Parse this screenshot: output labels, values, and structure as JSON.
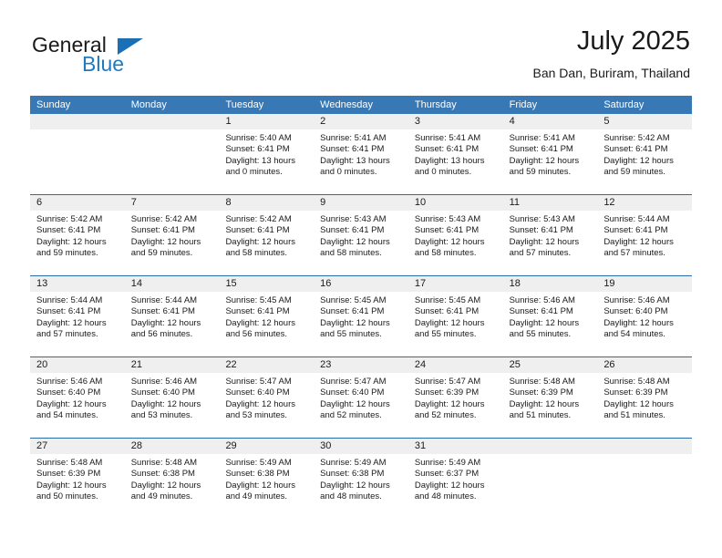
{
  "brand": {
    "name_top": "General",
    "name_bottom": "Blue",
    "accent_color": "#1f7bc1"
  },
  "header": {
    "title": "July 2025",
    "subtitle": "Ban Dan, Buriram, Thailand"
  },
  "theme": {
    "header_blue": "#3878b4",
    "row_divider_blue": "#2c6ca8",
    "day_band_gray": "#efefef"
  },
  "weekdays": [
    "Sunday",
    "Monday",
    "Tuesday",
    "Wednesday",
    "Thursday",
    "Friday",
    "Saturday"
  ],
  "weeks": [
    [
      {
        "day": "",
        "empty": true,
        "sunrise": "",
        "sunset": "",
        "daylight_1": "",
        "daylight_2": ""
      },
      {
        "day": "",
        "empty": true,
        "sunrise": "",
        "sunset": "",
        "daylight_1": "",
        "daylight_2": ""
      },
      {
        "day": "1",
        "sunrise": "Sunrise: 5:40 AM",
        "sunset": "Sunset: 6:41 PM",
        "daylight_1": "Daylight: 13 hours",
        "daylight_2": "and 0 minutes."
      },
      {
        "day": "2",
        "sunrise": "Sunrise: 5:41 AM",
        "sunset": "Sunset: 6:41 PM",
        "daylight_1": "Daylight: 13 hours",
        "daylight_2": "and 0 minutes."
      },
      {
        "day": "3",
        "sunrise": "Sunrise: 5:41 AM",
        "sunset": "Sunset: 6:41 PM",
        "daylight_1": "Daylight: 13 hours",
        "daylight_2": "and 0 minutes."
      },
      {
        "day": "4",
        "sunrise": "Sunrise: 5:41 AM",
        "sunset": "Sunset: 6:41 PM",
        "daylight_1": "Daylight: 12 hours",
        "daylight_2": "and 59 minutes."
      },
      {
        "day": "5",
        "sunrise": "Sunrise: 5:42 AM",
        "sunset": "Sunset: 6:41 PM",
        "daylight_1": "Daylight: 12 hours",
        "daylight_2": "and 59 minutes."
      }
    ],
    [
      {
        "day": "6",
        "sunrise": "Sunrise: 5:42 AM",
        "sunset": "Sunset: 6:41 PM",
        "daylight_1": "Daylight: 12 hours",
        "daylight_2": "and 59 minutes."
      },
      {
        "day": "7",
        "sunrise": "Sunrise: 5:42 AM",
        "sunset": "Sunset: 6:41 PM",
        "daylight_1": "Daylight: 12 hours",
        "daylight_2": "and 59 minutes."
      },
      {
        "day": "8",
        "sunrise": "Sunrise: 5:42 AM",
        "sunset": "Sunset: 6:41 PM",
        "daylight_1": "Daylight: 12 hours",
        "daylight_2": "and 58 minutes."
      },
      {
        "day": "9",
        "sunrise": "Sunrise: 5:43 AM",
        "sunset": "Sunset: 6:41 PM",
        "daylight_1": "Daylight: 12 hours",
        "daylight_2": "and 58 minutes."
      },
      {
        "day": "10",
        "sunrise": "Sunrise: 5:43 AM",
        "sunset": "Sunset: 6:41 PM",
        "daylight_1": "Daylight: 12 hours",
        "daylight_2": "and 58 minutes."
      },
      {
        "day": "11",
        "sunrise": "Sunrise: 5:43 AM",
        "sunset": "Sunset: 6:41 PM",
        "daylight_1": "Daylight: 12 hours",
        "daylight_2": "and 57 minutes."
      },
      {
        "day": "12",
        "sunrise": "Sunrise: 5:44 AM",
        "sunset": "Sunset: 6:41 PM",
        "daylight_1": "Daylight: 12 hours",
        "daylight_2": "and 57 minutes."
      }
    ],
    [
      {
        "day": "13",
        "sunrise": "Sunrise: 5:44 AM",
        "sunset": "Sunset: 6:41 PM",
        "daylight_1": "Daylight: 12 hours",
        "daylight_2": "and 57 minutes."
      },
      {
        "day": "14",
        "sunrise": "Sunrise: 5:44 AM",
        "sunset": "Sunset: 6:41 PM",
        "daylight_1": "Daylight: 12 hours",
        "daylight_2": "and 56 minutes."
      },
      {
        "day": "15",
        "sunrise": "Sunrise: 5:45 AM",
        "sunset": "Sunset: 6:41 PM",
        "daylight_1": "Daylight: 12 hours",
        "daylight_2": "and 56 minutes."
      },
      {
        "day": "16",
        "sunrise": "Sunrise: 5:45 AM",
        "sunset": "Sunset: 6:41 PM",
        "daylight_1": "Daylight: 12 hours",
        "daylight_2": "and 55 minutes."
      },
      {
        "day": "17",
        "sunrise": "Sunrise: 5:45 AM",
        "sunset": "Sunset: 6:41 PM",
        "daylight_1": "Daylight: 12 hours",
        "daylight_2": "and 55 minutes."
      },
      {
        "day": "18",
        "sunrise": "Sunrise: 5:46 AM",
        "sunset": "Sunset: 6:41 PM",
        "daylight_1": "Daylight: 12 hours",
        "daylight_2": "and 55 minutes."
      },
      {
        "day": "19",
        "sunrise": "Sunrise: 5:46 AM",
        "sunset": "Sunset: 6:40 PM",
        "daylight_1": "Daylight: 12 hours",
        "daylight_2": "and 54 minutes."
      }
    ],
    [
      {
        "day": "20",
        "sunrise": "Sunrise: 5:46 AM",
        "sunset": "Sunset: 6:40 PM",
        "daylight_1": "Daylight: 12 hours",
        "daylight_2": "and 54 minutes."
      },
      {
        "day": "21",
        "sunrise": "Sunrise: 5:46 AM",
        "sunset": "Sunset: 6:40 PM",
        "daylight_1": "Daylight: 12 hours",
        "daylight_2": "and 53 minutes."
      },
      {
        "day": "22",
        "sunrise": "Sunrise: 5:47 AM",
        "sunset": "Sunset: 6:40 PM",
        "daylight_1": "Daylight: 12 hours",
        "daylight_2": "and 53 minutes."
      },
      {
        "day": "23",
        "sunrise": "Sunrise: 5:47 AM",
        "sunset": "Sunset: 6:40 PM",
        "daylight_1": "Daylight: 12 hours",
        "daylight_2": "and 52 minutes."
      },
      {
        "day": "24",
        "sunrise": "Sunrise: 5:47 AM",
        "sunset": "Sunset: 6:39 PM",
        "daylight_1": "Daylight: 12 hours",
        "daylight_2": "and 52 minutes."
      },
      {
        "day": "25",
        "sunrise": "Sunrise: 5:48 AM",
        "sunset": "Sunset: 6:39 PM",
        "daylight_1": "Daylight: 12 hours",
        "daylight_2": "and 51 minutes."
      },
      {
        "day": "26",
        "sunrise": "Sunrise: 5:48 AM",
        "sunset": "Sunset: 6:39 PM",
        "daylight_1": "Daylight: 12 hours",
        "daylight_2": "and 51 minutes."
      }
    ],
    [
      {
        "day": "27",
        "sunrise": "Sunrise: 5:48 AM",
        "sunset": "Sunset: 6:39 PM",
        "daylight_1": "Daylight: 12 hours",
        "daylight_2": "and 50 minutes."
      },
      {
        "day": "28",
        "sunrise": "Sunrise: 5:48 AM",
        "sunset": "Sunset: 6:38 PM",
        "daylight_1": "Daylight: 12 hours",
        "daylight_2": "and 49 minutes."
      },
      {
        "day": "29",
        "sunrise": "Sunrise: 5:49 AM",
        "sunset": "Sunset: 6:38 PM",
        "daylight_1": "Daylight: 12 hours",
        "daylight_2": "and 49 minutes."
      },
      {
        "day": "30",
        "sunrise": "Sunrise: 5:49 AM",
        "sunset": "Sunset: 6:38 PM",
        "daylight_1": "Daylight: 12 hours",
        "daylight_2": "and 48 minutes."
      },
      {
        "day": "31",
        "sunrise": "Sunrise: 5:49 AM",
        "sunset": "Sunset: 6:37 PM",
        "daylight_1": "Daylight: 12 hours",
        "daylight_2": "and 48 minutes."
      },
      {
        "day": "",
        "empty": true,
        "sunrise": "",
        "sunset": "",
        "daylight_1": "",
        "daylight_2": ""
      },
      {
        "day": "",
        "empty": true,
        "sunrise": "",
        "sunset": "",
        "daylight_1": "",
        "daylight_2": ""
      }
    ]
  ]
}
